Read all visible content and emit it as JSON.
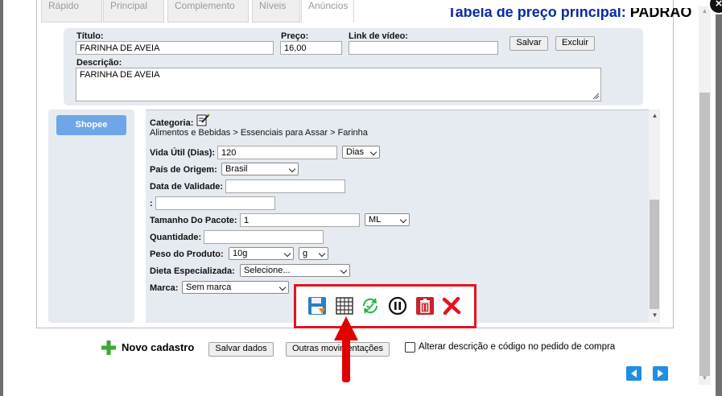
{
  "tabs": [
    "Rápido",
    "Principal",
    "Complemento",
    "Níveis",
    "Anúncios"
  ],
  "price_table": {
    "label": "Tabela de preço principal:",
    "name": "PADRÃO"
  },
  "form": {
    "title_label": "Título:",
    "title_value": "FARINHA DE AVEIA",
    "price_label": "Preço:",
    "price_value": "16,00",
    "video_label": "Link de vídeo:",
    "video_value": "",
    "save_btn": "Salvar",
    "delete_btn": "Excluir",
    "description_label": "Descrição:",
    "description_value": "FARINHA DE AVEIA"
  },
  "marketplace_button": "Shopee",
  "attributes": {
    "category_label": "Categoria:",
    "category_path": "Alimentos e Bebidas > Essenciais para Assar > Farinha",
    "shelf_life_label": "Vida Útil (Dias):",
    "shelf_life_value": "120",
    "shelf_life_unit": "Dias",
    "origin_label": "País de Origem:",
    "origin_value": "Brasil",
    "validity_label": "Data de Validade:",
    "blank_label": ":",
    "package_size_label": "Tamanho Do Pacote:",
    "package_size_value": "1",
    "package_size_unit": "ML",
    "quantity_label": "Quantidade:",
    "weight_label": "Peso do Produto:",
    "weight_value": "10g",
    "weight_unit": "g",
    "diet_label": "Dieta Especializada:",
    "diet_value": "Selecione...",
    "brand_label": "Marca:",
    "brand_value": "Sem marca"
  },
  "toolbar_icons": [
    "save-icon",
    "grid-icon",
    "sync-check-icon",
    "pause-icon",
    "trash-icon",
    "close-x-icon"
  ],
  "bottom": {
    "new_label": "Novo cadastro",
    "save_data": "Salvar dados",
    "movements": "Outras movimentações",
    "checkbox_label": "Alterar descrição e código no pedido de compra"
  },
  "colors": {
    "accent_blue": "#1f8fe3",
    "shopee_btn": "#6ea6e8",
    "highlight_red": "#e3141e"
  }
}
